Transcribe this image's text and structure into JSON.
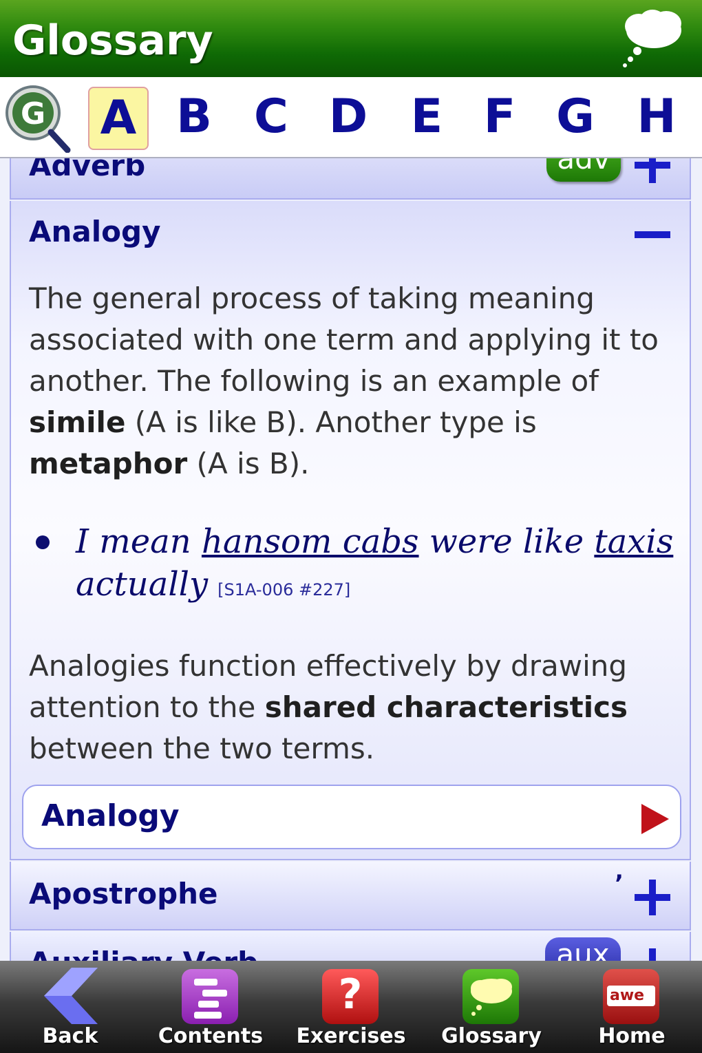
{
  "header": {
    "title": "Glossary",
    "icon": "thought-cloud-icon"
  },
  "alphabet": {
    "search_letter": "G",
    "letters": [
      "A",
      "B",
      "C",
      "D",
      "E",
      "F",
      "G",
      "H"
    ],
    "active": "A"
  },
  "entries": {
    "adverb": {
      "title": "Adverb",
      "tag": "adv"
    },
    "analogy": {
      "title": "Analogy",
      "def_p1_a": "The general process of taking meaning associated with one term and applying it to another. The following is an example of ",
      "def_p1_b": "simile",
      "def_p1_c": " (A is like B). Another type is ",
      "def_p1_d": "metaphor",
      "def_p1_e": " (A is B).",
      "example_a": "I mean ",
      "example_b": "hansom cabs",
      "example_c": " were like ",
      "example_d": "taxis",
      "example_e": " actually",
      "example_ref": "[S1A-006 #227]",
      "def_p2_a": "Analogies function effectively by drawing attention to the ",
      "def_p2_b": "shared characteristics",
      "def_p2_c": " between the two terms.",
      "link_label": "Analogy"
    },
    "apostrophe": {
      "title": "Apostrophe",
      "mark": "’"
    },
    "auxiliary": {
      "title": "Auxiliary Verb",
      "tag": "aux"
    }
  },
  "nav": [
    {
      "label": "Back",
      "icon": "back-arrow-icon"
    },
    {
      "label": "Contents",
      "icon": "contents-icon"
    },
    {
      "label": "Exercises",
      "icon": "exercises-icon"
    },
    {
      "label": "Glossary",
      "icon": "glossary-icon"
    },
    {
      "label": "Home",
      "icon": "home-icon"
    }
  ],
  "colors": {
    "header_green": "#1d7806",
    "letter_blue": "#0d0e96",
    "plus_blue": "#1a1ec8",
    "arrow_red": "#c0121a"
  }
}
